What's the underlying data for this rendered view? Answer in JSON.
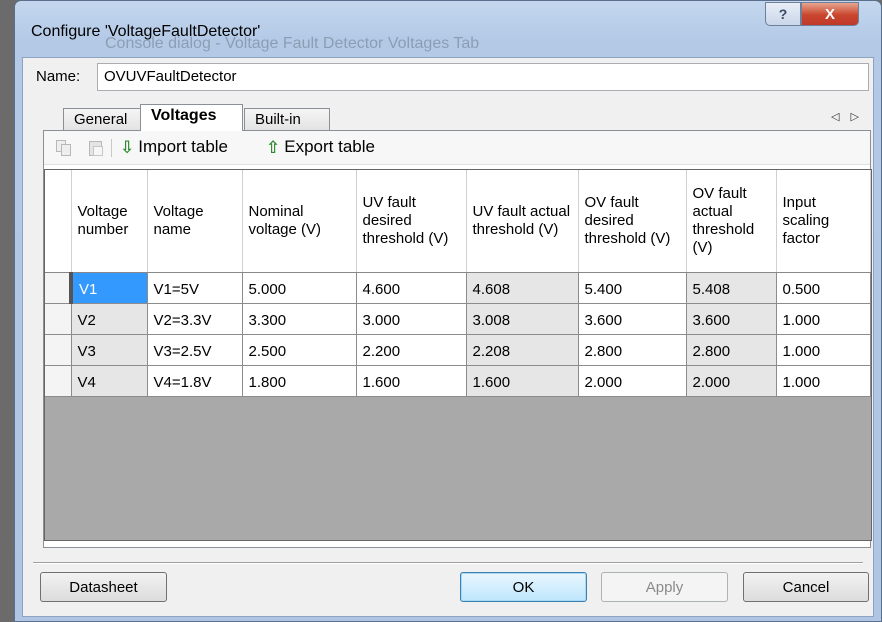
{
  "window": {
    "title": "Configure 'VoltageFaultDetector'",
    "ghost_title": "Console dialog - Voltage Fault Detector Voltages Tab",
    "help_glyph": "?",
    "close_glyph": "X"
  },
  "name_field": {
    "label": "Name:",
    "value": "OVUVFaultDetector"
  },
  "tabs": [
    {
      "label": "General",
      "active": false
    },
    {
      "label": "Voltages",
      "active": true
    },
    {
      "label": "Built-in",
      "active": false
    }
  ],
  "tab_scroll": "◁ ▷",
  "toolbar": {
    "import_label": "Import table",
    "export_label": "Export table",
    "import_arrow": "⇩",
    "export_arrow": "⇧"
  },
  "table": {
    "columns": [
      "Voltage number",
      "Voltage name",
      "Nominal voltage (V)",
      "UV fault desired threshold (V)",
      "UV fault actual threshold (V)",
      "OV fault desired threshold (V)",
      "OV fault actual threshold (V)",
      "Input scaling factor"
    ],
    "rows": [
      [
        "V1",
        "V1=5V",
        "5.000",
        "4.600",
        "4.608",
        "5.400",
        "5.408",
        "0.500"
      ],
      [
        "V2",
        "V2=3.3V",
        "3.300",
        "3.000",
        "3.008",
        "3.600",
        "3.600",
        "1.000"
      ],
      [
        "V3",
        "V3=2.5V",
        "2.500",
        "2.200",
        "2.208",
        "2.800",
        "2.800",
        "1.000"
      ],
      [
        "V4",
        "V4=1.8V",
        "1.800",
        "1.600",
        "1.600",
        "2.000",
        "2.000",
        "1.000"
      ]
    ]
  },
  "buttons": {
    "datasheet": "Datasheet",
    "ok": "OK",
    "apply": "Apply",
    "cancel": "Cancel"
  },
  "colors": {
    "selection": "#3399ff",
    "readonly_cell": "#e6e6e6",
    "empty_grid": "#a9a9a9"
  }
}
